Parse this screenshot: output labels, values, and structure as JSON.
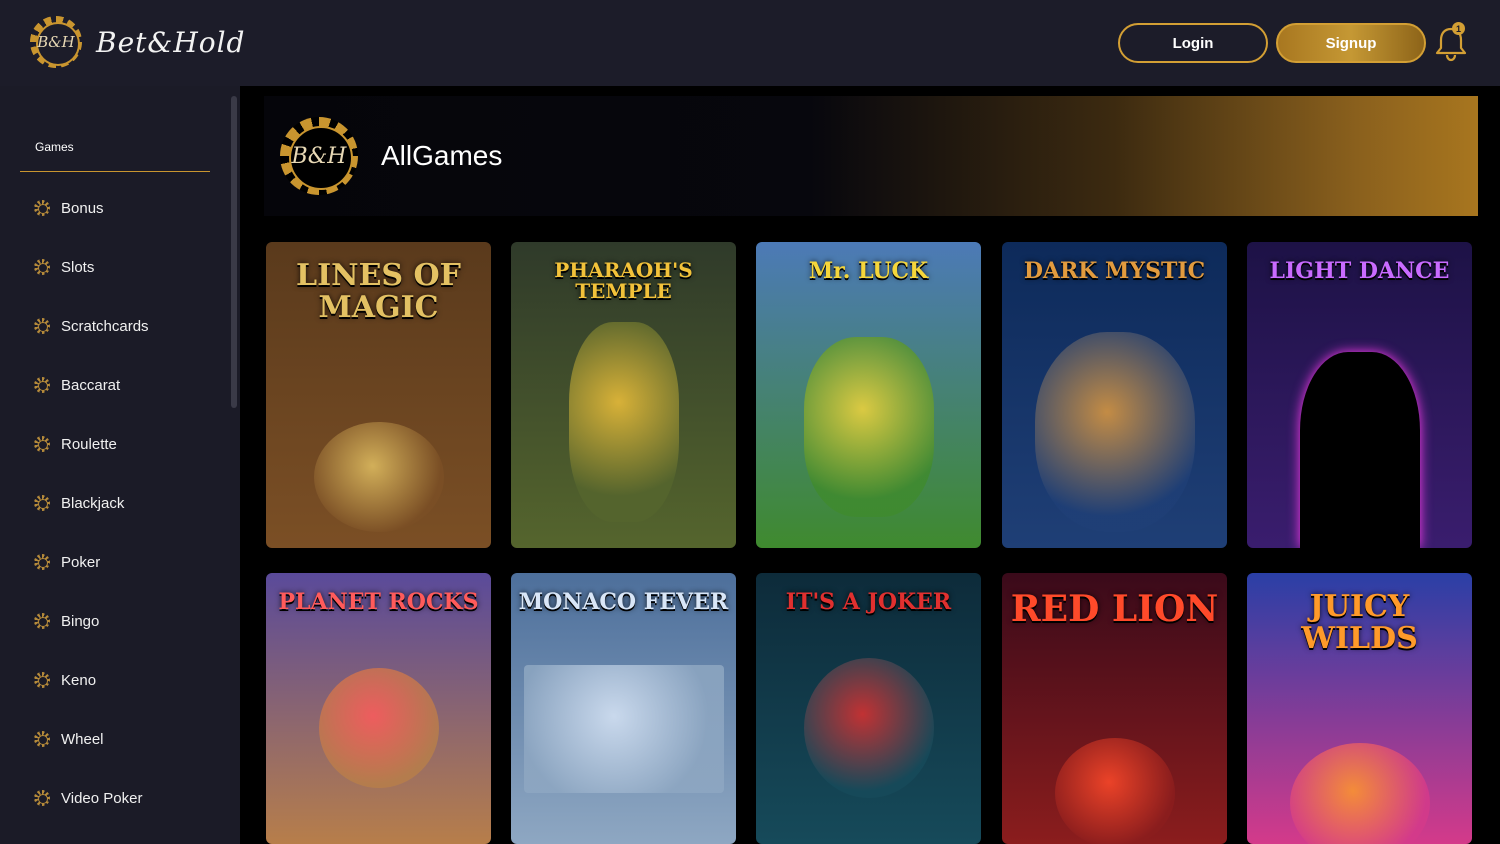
{
  "header": {
    "logo_text": "Bet&Hold",
    "logo_chip_text": "B&H",
    "login_label": "Login",
    "signup_label": "Signup",
    "notification_count": "1"
  },
  "sidebar": {
    "heading": "Games",
    "items": [
      {
        "label": "Bonus"
      },
      {
        "label": "Slots"
      },
      {
        "label": "Scratchcards"
      },
      {
        "label": "Baccarat"
      },
      {
        "label": "Roulette"
      },
      {
        "label": "Blackjack"
      },
      {
        "label": "Poker"
      },
      {
        "label": "Bingo"
      },
      {
        "label": "Keno"
      },
      {
        "label": "Wheel"
      },
      {
        "label": "Video Poker"
      }
    ]
  },
  "banner": {
    "title": "AllGames",
    "chip_text": "B&H"
  },
  "games": [
    {
      "title": "LINES OF MAGIC",
      "colors": [
        "#5a3a1c",
        "#7b4f25"
      ],
      "title_color": "#e3c163"
    },
    {
      "title": "PHARAOH'S TEMPLE",
      "colors": [
        "#2f3a2a",
        "#55652d"
      ],
      "title_color": "#f2c23a"
    },
    {
      "title": "Mr. LUCK",
      "colors": [
        "#4c7ab7",
        "#3f8a2e"
      ],
      "title_color": "#f5d63b"
    },
    {
      "title": "DARK MYSTIC",
      "colors": [
        "#0d2a5a",
        "#1f3f76"
      ],
      "title_color": "#e29b3e"
    },
    {
      "title": "LIGHT DANCE",
      "colors": [
        "#1d1246",
        "#3a1d6e"
      ],
      "title_color": "#c96bff"
    },
    {
      "title": "PLANET ROCKS",
      "colors": [
        "#5a4a9a",
        "#b77e4a"
      ],
      "title_color": "#ff5b5b"
    },
    {
      "title": "MONACO FEVER",
      "colors": [
        "#4d6f9b",
        "#8ea7c2"
      ],
      "title_color": "#d9e6f7"
    },
    {
      "title": "IT'S A JOKER",
      "colors": [
        "#0d2b3a",
        "#164a5a"
      ],
      "title_color": "#e0302f"
    },
    {
      "title": "RED LION",
      "colors": [
        "#3a0a1a",
        "#8b1d1d"
      ],
      "title_color": "#ff4a2a"
    },
    {
      "title": "JUICY WILDS",
      "colors": [
        "#2a3fa6",
        "#d43a8a"
      ],
      "title_color": "#ff9a2a"
    }
  ]
}
